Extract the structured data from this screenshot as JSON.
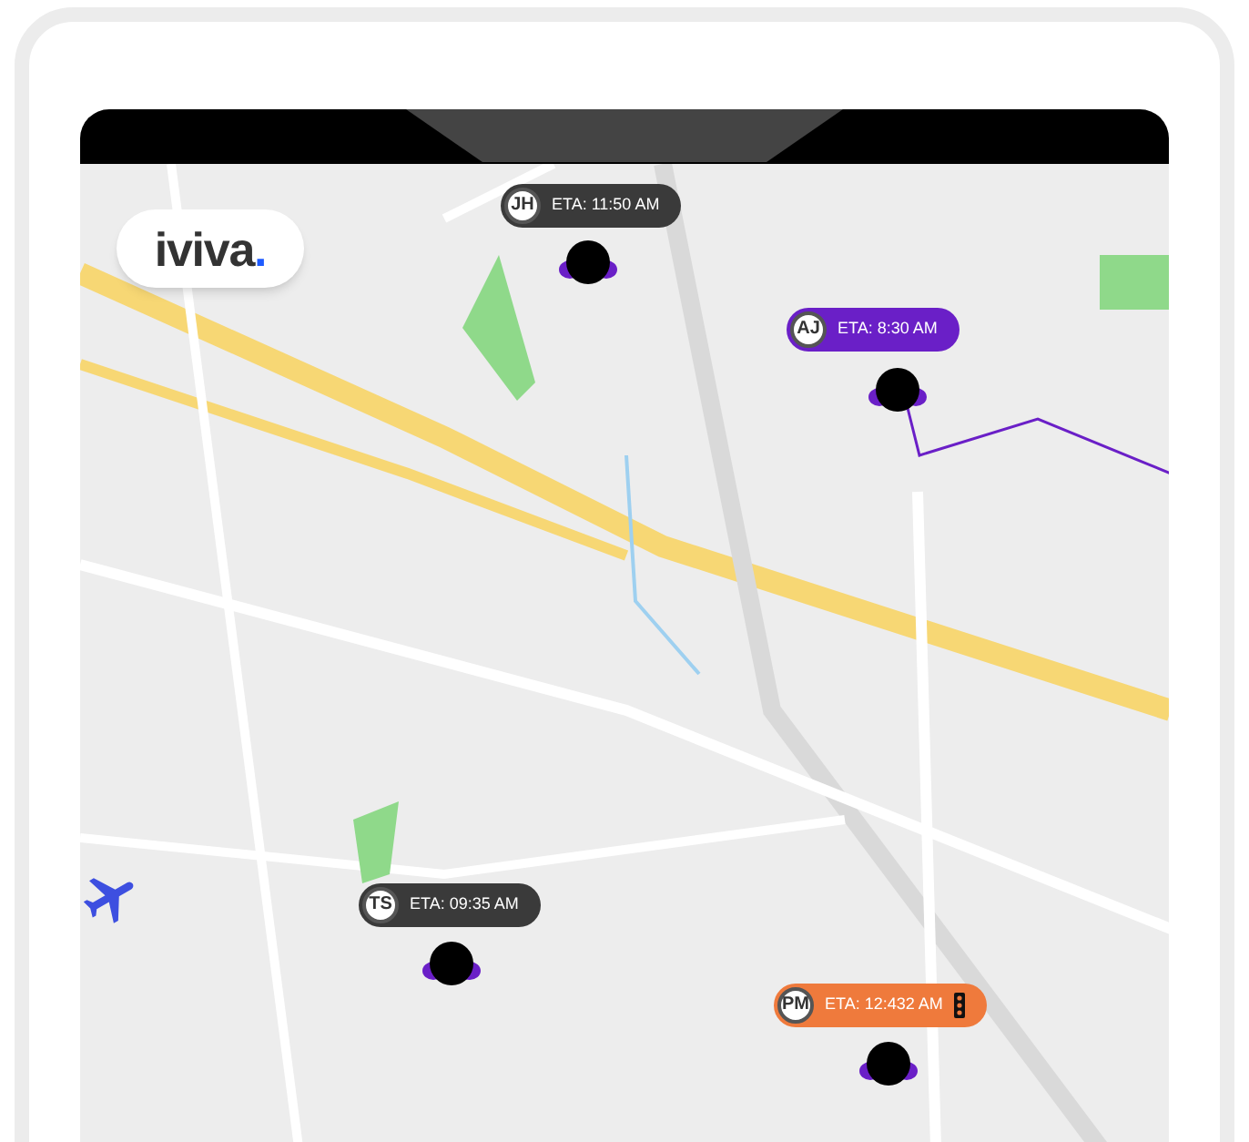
{
  "logo": {
    "text": "iviva",
    "accent": "."
  },
  "markers": [
    {
      "initials": "JH",
      "eta": "ETA: 11:50 AM",
      "color": "#3a3a3a",
      "alert": false
    },
    {
      "initials": "AJ",
      "eta": "ETA: 8:30 AM",
      "color": "#6a1fc7",
      "alert": false
    },
    {
      "initials": "TS",
      "eta": "ETA: 09:35 AM",
      "color": "#3a3a3a",
      "alert": false
    },
    {
      "initials": "PM",
      "eta": "ETA: 12:432 AM",
      "color": "#ef7a3c",
      "alert": true
    }
  ]
}
